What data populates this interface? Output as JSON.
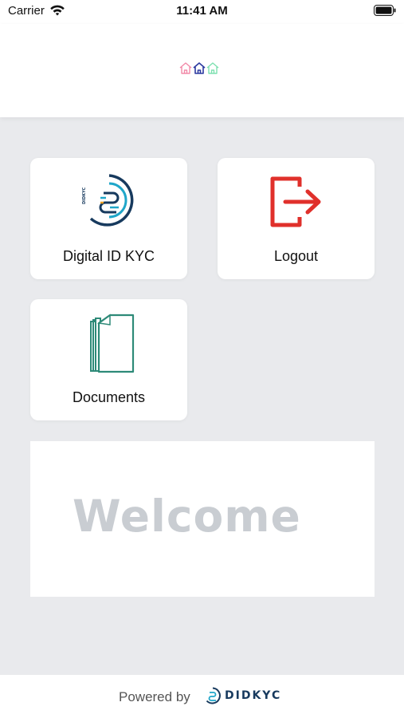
{
  "status_bar": {
    "carrier": "Carrier",
    "time": "11:41 AM",
    "icons": [
      "wifi-icon",
      "battery-icon"
    ]
  },
  "header": {
    "icons": [
      "home-icon-pink",
      "home-icon-navy",
      "home-icon-mint"
    ],
    "colors": {
      "home_pink": "#f28aa8",
      "home_navy": "#2c3aa0",
      "home_mint": "#7ee0b0"
    }
  },
  "tiles": [
    {
      "label": "Digital ID KYC",
      "icon": "didkyc-logo-icon"
    },
    {
      "label": "Logout",
      "icon": "logout-icon"
    },
    {
      "label": "Documents",
      "icon": "documents-icon"
    }
  ],
  "welcome": {
    "text": "Welcome"
  },
  "footer": {
    "powered_by": "Powered by",
    "brand": "DIDKYC"
  },
  "colors": {
    "background": "#e9eaed",
    "logout_red": "#e0302b",
    "doc_green": "#2e8a78",
    "brand_navy": "#173a5e",
    "brand_teal": "#1fa6c9"
  }
}
